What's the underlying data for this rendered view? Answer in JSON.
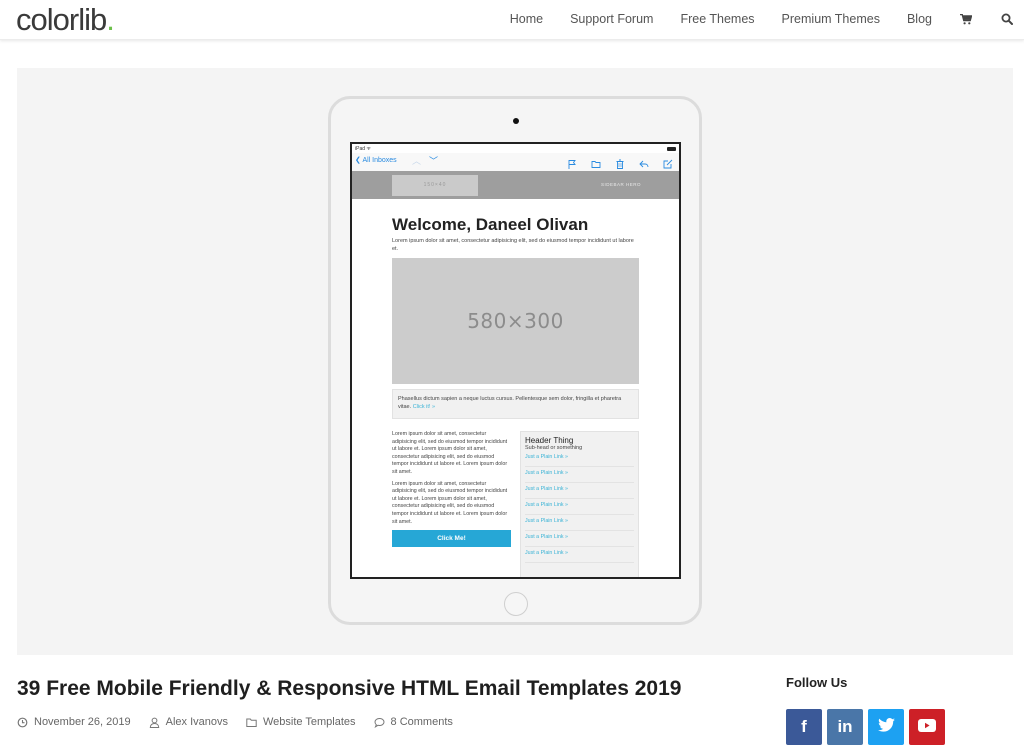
{
  "header": {
    "logo_text": "colorlib",
    "logo_dot": ".",
    "nav": [
      {
        "label": "Home"
      },
      {
        "label": "Support Forum"
      },
      {
        "label": "Free Themes"
      },
      {
        "label": "Premium Themes"
      },
      {
        "label": "Blog"
      }
    ],
    "icons": {
      "cart": "cart-icon",
      "search": "search-icon"
    }
  },
  "hero": {
    "device": "iPad",
    "status_label": "iPad",
    "mail": {
      "back_label": "All Inboxes",
      "toolbar_icons": [
        "flag-icon",
        "folder-icon",
        "trash-icon",
        "reply-icon",
        "compose-icon"
      ]
    },
    "email": {
      "logo_placeholder": "150×40",
      "hero_label": "SIDEBAR HERO",
      "heading": "Welcome, Daneel Olivan",
      "lead": "Lorem ipsum dolor sit amet, consectetur adipisicing elit, sed do eiusmod tempor incididunt ut labore et.",
      "image_placeholder": "580×300",
      "callout_text": "Phasellus dictum sapien a neque luctus cursus. Pellentesque sem dolor, fringilla et pharetra vitae.",
      "callout_link": "Click it! »",
      "left_paragraphs": [
        "Lorem ipsum dolor sit amet, consectetur adipisicing elit, sed do eiusmod tempor incididunt ut labore et. Lorem ipsum dolor sit amet, consectetur adipisicing elit, sed do eiusmod tempor incididunt ut labore et. Lorem ipsum dolor sit amet.",
        "Lorem ipsum dolor sit amet, consectetur adipisicing elit, sed do eiusmod tempor incididunt ut labore et. Lorem ipsum dolor sit amet, consectetur adipisicing elit, sed do eiusmod tempor incididunt ut labore et. Lorem ipsum dolor sit amet."
      ],
      "button_label": "Click Me!",
      "sidebar": {
        "heading": "Header Thing",
        "subhead": "Sub-head or something",
        "links": [
          "Just a Plain Link »",
          "Just a Plain Link »",
          "Just a Plain Link »",
          "Just a Plain Link »",
          "Just a Plain Link »",
          "Just a Plain Link »",
          "Just a Plain Link »"
        ]
      }
    }
  },
  "article": {
    "title": "39 Free Mobile Friendly & Responsive HTML Email Templates 2019",
    "meta": {
      "date": "November 26, 2019",
      "author": "Alex Ivanovs",
      "category": "Website Templates",
      "comments": "8 Comments"
    }
  },
  "sidebar": {
    "follow_title": "Follow Us",
    "social": [
      {
        "name": "facebook",
        "glyph": "f",
        "color": "#3b5998"
      },
      {
        "name": "linkedin",
        "glyph": "in",
        "color": "#4a76a8"
      },
      {
        "name": "twitter",
        "glyph": "",
        "color": "#1da1f2"
      },
      {
        "name": "youtube",
        "glyph": "",
        "color": "#cd2027"
      }
    ]
  },
  "colors": {
    "accent_green": "#6cc04a",
    "email_button": "#26a7d6",
    "email_link": "#3ab3d6",
    "ios_blue": "#2a8be0"
  }
}
